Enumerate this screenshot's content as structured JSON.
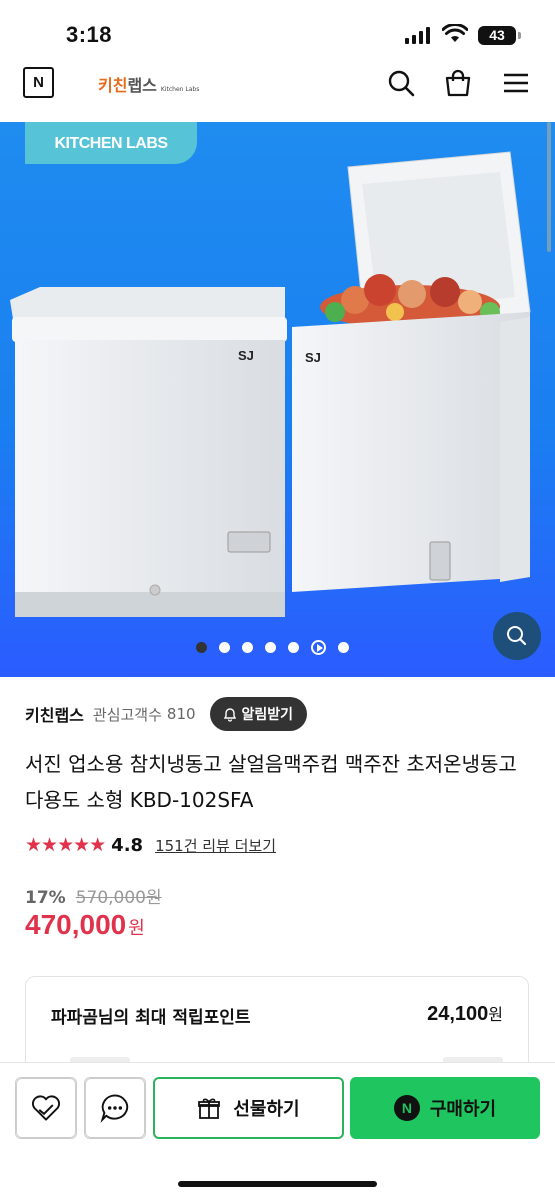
{
  "status_bar": {
    "time": "3:18",
    "battery": "43"
  },
  "header": {
    "brand_ko_1": "키친",
    "brand_ko_2": "랩스",
    "brand_en": "Kitchen Labs",
    "n_logo": "N"
  },
  "hero": {
    "badge": "KITCHEN LABS",
    "slide_count": 7,
    "active_index": 0,
    "product_logo": "SJ"
  },
  "store": {
    "name": "키친랩스",
    "follower_label": "관심고객수",
    "follower_count": "810",
    "alert_button": "알림받기"
  },
  "product": {
    "title": "서진 업소용 참치냉동고 살얼음맥주컵 맥주잔 초저온냉동고 다용도 소형 KBD-102SFA",
    "rating": "4.8",
    "stars": "★★★★★",
    "review_link": "151건 리뷰 더보기",
    "discount": "17%",
    "original_price": "570,000원",
    "sale_price": "470,000",
    "sale_unit": "원"
  },
  "points": {
    "label": "파파곰님의 최대 적립포인트",
    "value": "24,100",
    "unit": "원"
  },
  "bottom_bar": {
    "gift_label": "선물하기",
    "buy_label": "구매하기",
    "npay": "N"
  },
  "colors": {
    "accent_red": "#e0334b",
    "naver_green": "#1fc55f",
    "hero_blue": "#1a7ff0",
    "badge_teal": "#56c3d6"
  }
}
